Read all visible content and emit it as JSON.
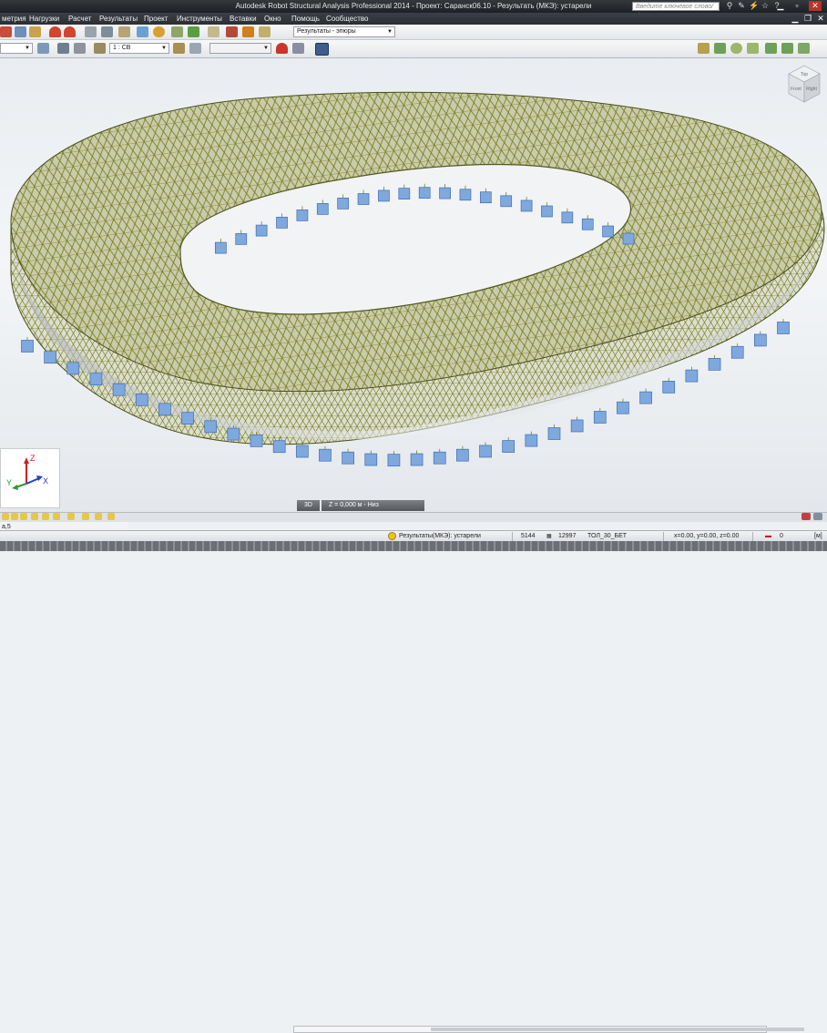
{
  "window": {
    "title": "Autodesk Robot Structural Analysis Professional 2014 - Проект: Саранск06.10 - Результать (МКЭ): устарели",
    "search_placeholder": "Введите ключевое слово/фразу"
  },
  "menu": {
    "items": [
      "метрия",
      "Нагрузки",
      "Расчет",
      "Результаты",
      "Проект",
      "Инструменты",
      "Вставки",
      "Окно",
      "Помощь",
      "Сообщество"
    ]
  },
  "toolbar": {
    "results_dropdown": "Результаты - эпюры",
    "case_dropdown": "1 : СВ"
  },
  "view": {
    "tab_3d": "3D",
    "tab_level": "Z = 0,000 м - Низ",
    "cube_top": "Top",
    "cube_front": "Front",
    "cube_right": "Right",
    "axis_x": "X",
    "axis_y": "Y",
    "axis_z": "Z"
  },
  "status": {
    "results_state": "Результаты(МКЭ): устарели",
    "nodes": "5144",
    "elements": "12997",
    "section": "ТОЛ_30_БЕТ",
    "coords": "x=0.00, y=0.00, z=0.00",
    "angle": "0",
    "units": "[м]",
    "left_label": "а,5"
  },
  "colors": {
    "mesh_shell": "#c8cca6",
    "mesh_line": "#7d7f1e",
    "support": "#7fa8df",
    "titlebar": "#26292d"
  }
}
